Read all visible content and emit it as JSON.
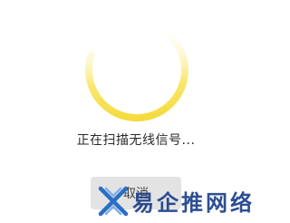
{
  "spinner": {
    "icon": "loading-spinner-icon",
    "arc_color": "#f6dd3a",
    "fade_color": "#ffffff"
  },
  "status": {
    "text": "正在扫描无线信号..."
  },
  "cancel": {
    "label": "取消"
  },
  "watermark": {
    "text": "易企推网络",
    "color": "#1c3f8a"
  }
}
